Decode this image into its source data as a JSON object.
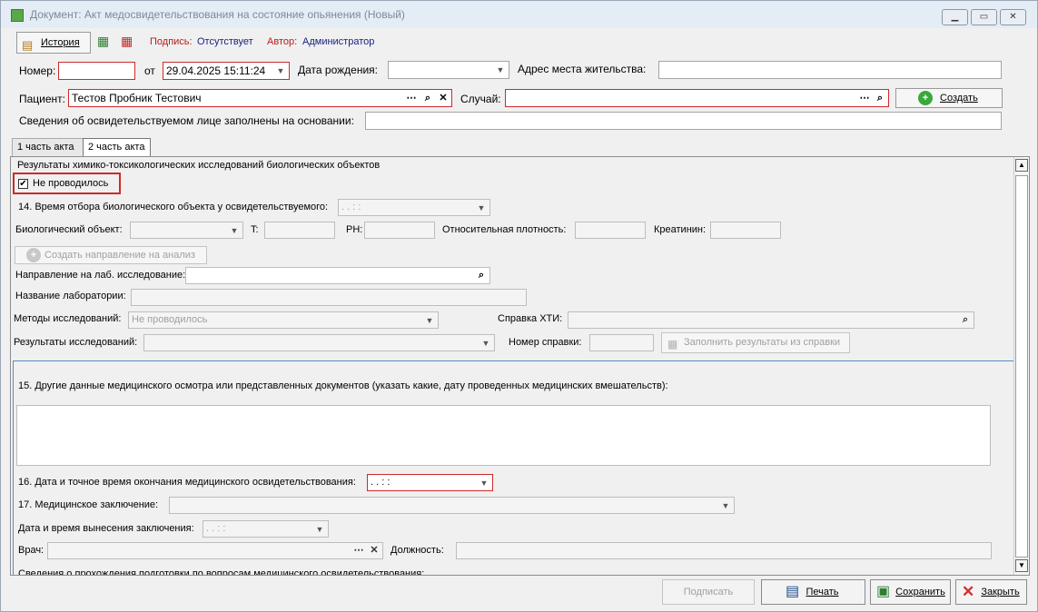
{
  "window": {
    "title": "Документ: Акт медосвидетельствования на состояние опьянения (Новый)"
  },
  "toolbar": {
    "history": "История",
    "sign_label": "Подпись:",
    "sign_value": "Отсутствует",
    "author_label": "Автор:",
    "author_value": "Администратор"
  },
  "header": {
    "number_label": "Номер:",
    "number_value": "",
    "from_label": "от",
    "date_value": "29.04.2025 15:11:24",
    "birth_label": "Дата рождения:",
    "address_label": "Адрес места жительства:",
    "patient_label": "Пациент:",
    "patient_value": "Тестов Пробник Тестович",
    "case_label": "Случай:",
    "create_label": "Создать",
    "basis_label": "Сведения об освидетельствуемом лице заполнены на основании:"
  },
  "tabs": [
    {
      "label": "1 часть акта"
    },
    {
      "label": "2 часть акта"
    }
  ],
  "part2": {
    "results_title": "Результаты химико-токсикологических исследований биологических объектов",
    "not_done_label": "Не проводилось",
    "time14_label": "14. Время отбора биологического объекта у освидетельствуемого:",
    "time14_value": "  .  .       :  :",
    "bio_label": "Биологический объект:",
    "t_label": "T:",
    "ph_label": "PH:",
    "density_label": "Относительная плотность:",
    "creat_label": "Креатинин:",
    "create_dir_label": "Создать направление на анализ",
    "dir_label": "Направление на лаб. исследование:",
    "lab_label": "Название лаборатории:",
    "methods_label": "Методы исследований:",
    "methods_value": "Не проводилось",
    "hti_label": "Справка ХТИ:",
    "results_label": "Результаты исследований:",
    "cert_label": "Номер справки:",
    "fill_label": "Заполнить результаты из справки",
    "other15_label": "15. Другие данные медицинского осмотра или представленных документов (указать какие, дату проведенных медицинских вмешательств):",
    "end16_label": "16. Дата и точное время окончания медицинского освидетельствования:",
    "end16_value": "  .  .       :  :",
    "concl17_label": "17. Медицинское заключение:",
    "concl_dt_label": "Дата и время вынесения заключения:",
    "concl_dt_value": "  .  .       :  :",
    "doctor_label": "Врач:",
    "position_label": "Должность:",
    "training_label": "Сведения о прохождения подготовки по вопросам медицинского освидетельствования:"
  },
  "footer": {
    "sign": "Подписать",
    "print": "Печать",
    "save": "Сохранить",
    "close": "Закрыть"
  }
}
